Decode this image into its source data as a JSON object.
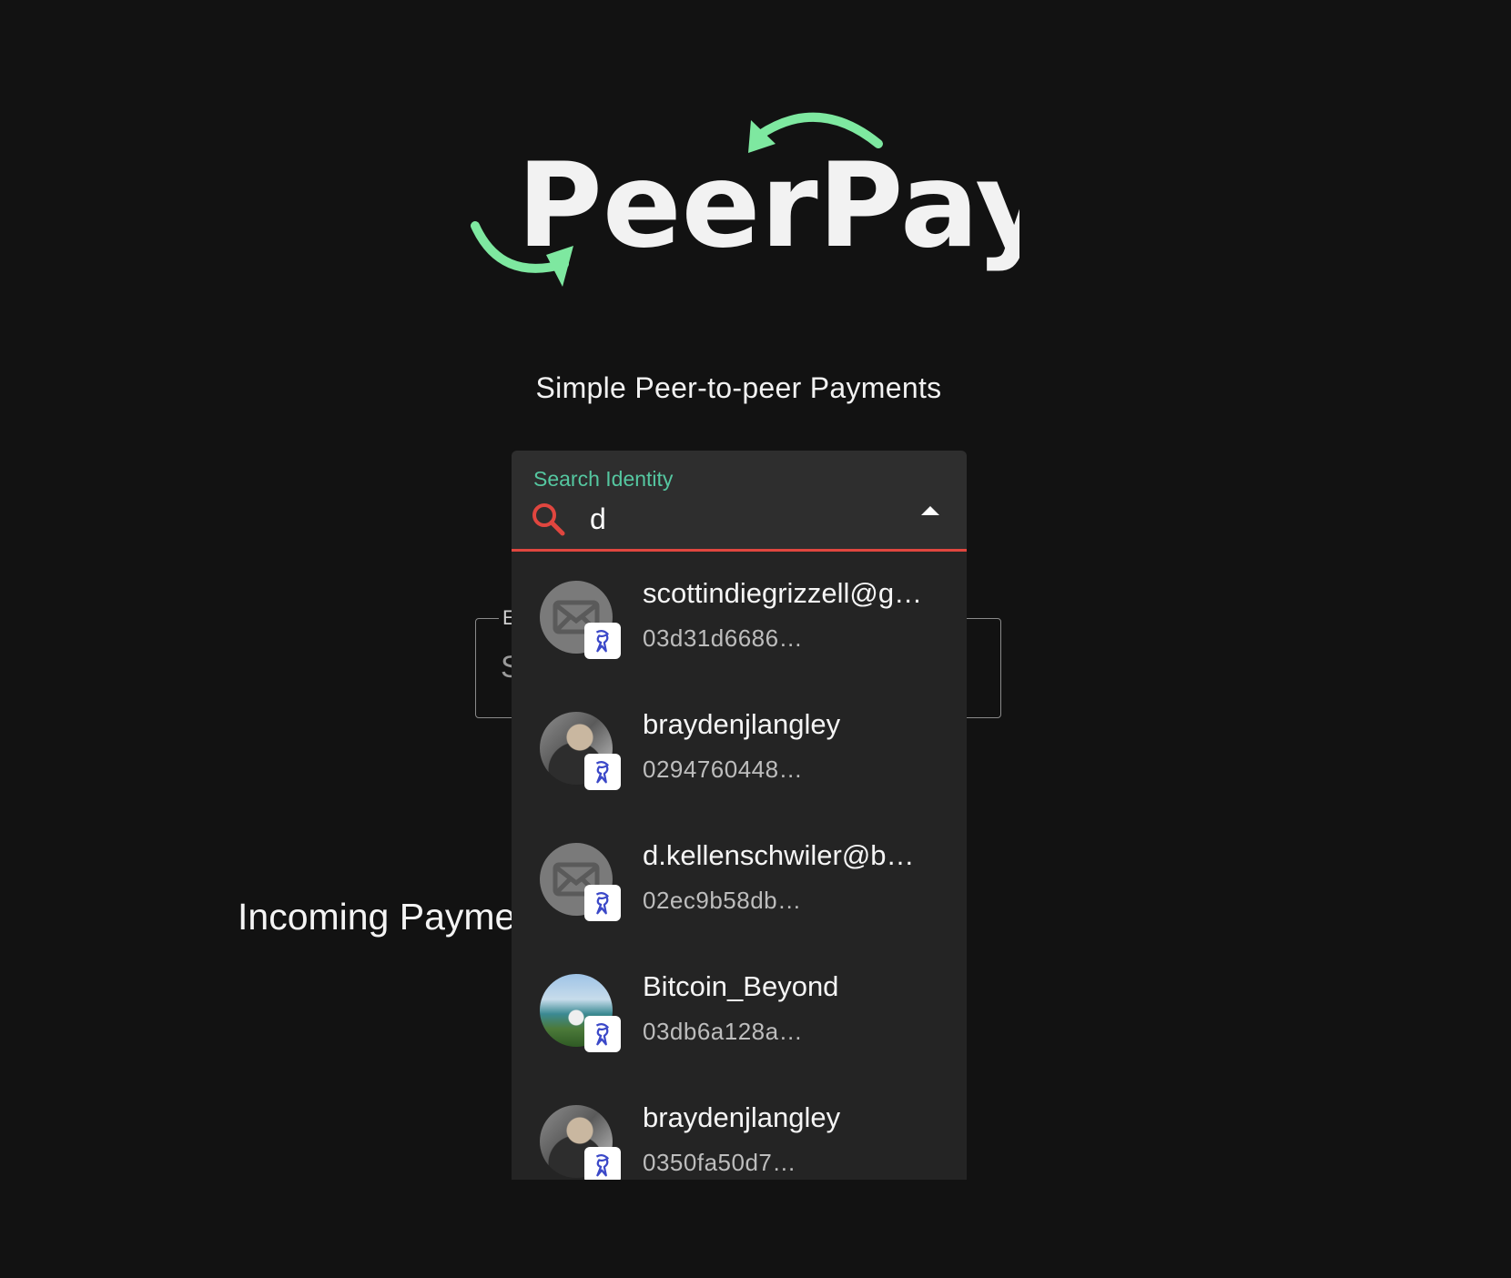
{
  "app": {
    "logo_text": "PeerPay",
    "tagline": "Simple Peer-to-peer Payments",
    "accent_color": "#7ee8a0",
    "error_color": "#e0463f",
    "label_color": "#55c7a0"
  },
  "search": {
    "label": "Search Identity",
    "value": "d",
    "icon": "search-icon",
    "toggle_icon": "arrow-up-icon"
  },
  "background": {
    "field_legend": "E",
    "field_value": "S",
    "incoming_heading": "Incoming Payme"
  },
  "results": [
    {
      "name": "scottindiegrizzell@g…",
      "key": "03d31d6686…",
      "avatar": "mail-icon",
      "badge": "identity-badge-icon"
    },
    {
      "name": "braydenjlangley",
      "key": "0294760448…",
      "avatar": "user-photo",
      "badge": "identity-badge-icon"
    },
    {
      "name": "d.kellenschwiler@b…",
      "key": "02ec9b58db…",
      "avatar": "mail-icon",
      "badge": "identity-badge-icon"
    },
    {
      "name": "Bitcoin_Beyond",
      "key": "03db6a128a…",
      "avatar": "user-photo",
      "badge": "identity-badge-icon"
    },
    {
      "name": "braydenjlangley",
      "key": "0350fa50d7…",
      "avatar": "user-photo",
      "badge": "identity-badge-icon"
    }
  ]
}
